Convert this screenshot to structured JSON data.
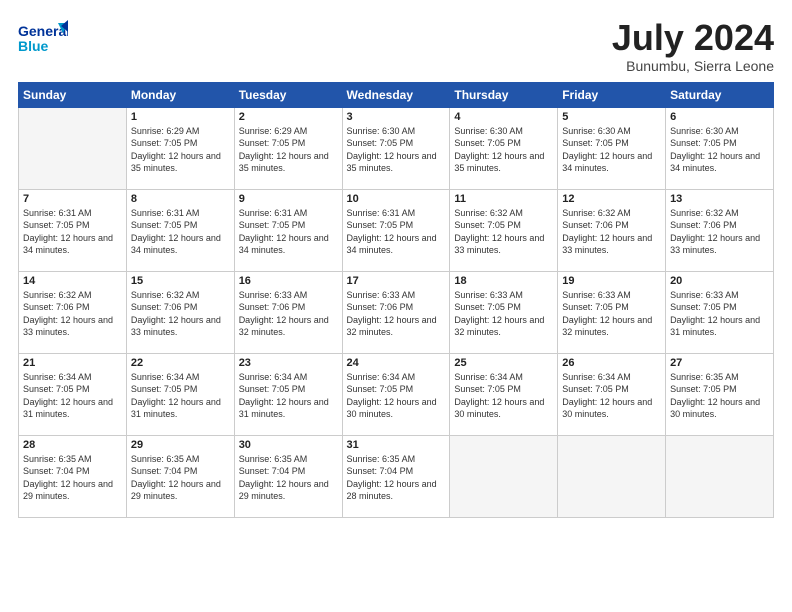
{
  "header": {
    "logo_general": "General",
    "logo_blue": "Blue",
    "month_year": "July 2024",
    "location": "Bunumbu, Sierra Leone"
  },
  "days_of_week": [
    "Sunday",
    "Monday",
    "Tuesday",
    "Wednesday",
    "Thursday",
    "Friday",
    "Saturday"
  ],
  "weeks": [
    [
      {
        "day": "",
        "sunrise": "",
        "sunset": "",
        "daylight": ""
      },
      {
        "day": "1",
        "sunrise": "6:29 AM",
        "sunset": "7:05 PM",
        "daylight": "12 hours and 35 minutes."
      },
      {
        "day": "2",
        "sunrise": "6:29 AM",
        "sunset": "7:05 PM",
        "daylight": "12 hours and 35 minutes."
      },
      {
        "day": "3",
        "sunrise": "6:30 AM",
        "sunset": "7:05 PM",
        "daylight": "12 hours and 35 minutes."
      },
      {
        "day": "4",
        "sunrise": "6:30 AM",
        "sunset": "7:05 PM",
        "daylight": "12 hours and 35 minutes."
      },
      {
        "day": "5",
        "sunrise": "6:30 AM",
        "sunset": "7:05 PM",
        "daylight": "12 hours and 34 minutes."
      },
      {
        "day": "6",
        "sunrise": "6:30 AM",
        "sunset": "7:05 PM",
        "daylight": "12 hours and 34 minutes."
      }
    ],
    [
      {
        "day": "7",
        "sunrise": "6:31 AM",
        "sunset": "7:05 PM",
        "daylight": "12 hours and 34 minutes."
      },
      {
        "day": "8",
        "sunrise": "6:31 AM",
        "sunset": "7:05 PM",
        "daylight": "12 hours and 34 minutes."
      },
      {
        "day": "9",
        "sunrise": "6:31 AM",
        "sunset": "7:05 PM",
        "daylight": "12 hours and 34 minutes."
      },
      {
        "day": "10",
        "sunrise": "6:31 AM",
        "sunset": "7:05 PM",
        "daylight": "12 hours and 34 minutes."
      },
      {
        "day": "11",
        "sunrise": "6:32 AM",
        "sunset": "7:05 PM",
        "daylight": "12 hours and 33 minutes."
      },
      {
        "day": "12",
        "sunrise": "6:32 AM",
        "sunset": "7:06 PM",
        "daylight": "12 hours and 33 minutes."
      },
      {
        "day": "13",
        "sunrise": "6:32 AM",
        "sunset": "7:06 PM",
        "daylight": "12 hours and 33 minutes."
      }
    ],
    [
      {
        "day": "14",
        "sunrise": "6:32 AM",
        "sunset": "7:06 PM",
        "daylight": "12 hours and 33 minutes."
      },
      {
        "day": "15",
        "sunrise": "6:32 AM",
        "sunset": "7:06 PM",
        "daylight": "12 hours and 33 minutes."
      },
      {
        "day": "16",
        "sunrise": "6:33 AM",
        "sunset": "7:06 PM",
        "daylight": "12 hours and 32 minutes."
      },
      {
        "day": "17",
        "sunrise": "6:33 AM",
        "sunset": "7:06 PM",
        "daylight": "12 hours and 32 minutes."
      },
      {
        "day": "18",
        "sunrise": "6:33 AM",
        "sunset": "7:05 PM",
        "daylight": "12 hours and 32 minutes."
      },
      {
        "day": "19",
        "sunrise": "6:33 AM",
        "sunset": "7:05 PM",
        "daylight": "12 hours and 32 minutes."
      },
      {
        "day": "20",
        "sunrise": "6:33 AM",
        "sunset": "7:05 PM",
        "daylight": "12 hours and 31 minutes."
      }
    ],
    [
      {
        "day": "21",
        "sunrise": "6:34 AM",
        "sunset": "7:05 PM",
        "daylight": "12 hours and 31 minutes."
      },
      {
        "day": "22",
        "sunrise": "6:34 AM",
        "sunset": "7:05 PM",
        "daylight": "12 hours and 31 minutes."
      },
      {
        "day": "23",
        "sunrise": "6:34 AM",
        "sunset": "7:05 PM",
        "daylight": "12 hours and 31 minutes."
      },
      {
        "day": "24",
        "sunrise": "6:34 AM",
        "sunset": "7:05 PM",
        "daylight": "12 hours and 30 minutes."
      },
      {
        "day": "25",
        "sunrise": "6:34 AM",
        "sunset": "7:05 PM",
        "daylight": "12 hours and 30 minutes."
      },
      {
        "day": "26",
        "sunrise": "6:34 AM",
        "sunset": "7:05 PM",
        "daylight": "12 hours and 30 minutes."
      },
      {
        "day": "27",
        "sunrise": "6:35 AM",
        "sunset": "7:05 PM",
        "daylight": "12 hours and 30 minutes."
      }
    ],
    [
      {
        "day": "28",
        "sunrise": "6:35 AM",
        "sunset": "7:04 PM",
        "daylight": "12 hours and 29 minutes."
      },
      {
        "day": "29",
        "sunrise": "6:35 AM",
        "sunset": "7:04 PM",
        "daylight": "12 hours and 29 minutes."
      },
      {
        "day": "30",
        "sunrise": "6:35 AM",
        "sunset": "7:04 PM",
        "daylight": "12 hours and 29 minutes."
      },
      {
        "day": "31",
        "sunrise": "6:35 AM",
        "sunset": "7:04 PM",
        "daylight": "12 hours and 28 minutes."
      },
      {
        "day": "",
        "sunrise": "",
        "sunset": "",
        "daylight": ""
      },
      {
        "day": "",
        "sunrise": "",
        "sunset": "",
        "daylight": ""
      },
      {
        "day": "",
        "sunrise": "",
        "sunset": "",
        "daylight": ""
      }
    ]
  ]
}
